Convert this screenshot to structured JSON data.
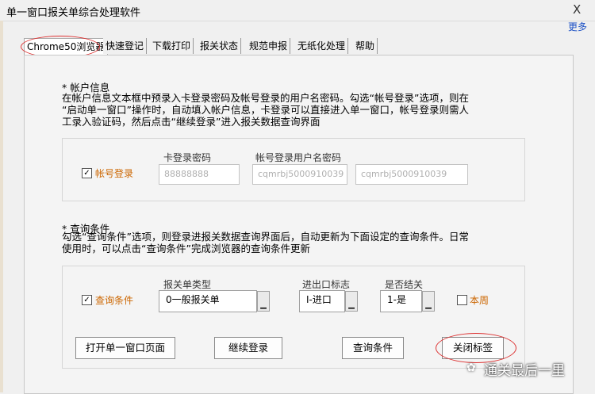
{
  "window": {
    "title": "单一窗口报关单综合处理软件",
    "close": "X",
    "more": "更多"
  },
  "tabs": [
    {
      "label": "Chrome50浏览器"
    },
    {
      "label": "快速登记"
    },
    {
      "label": "下载打印"
    },
    {
      "label": "报关状态"
    },
    {
      "label": "规范申报"
    },
    {
      "label": "无纸化处理"
    },
    {
      "label": "帮助"
    }
  ],
  "account": {
    "heading": "* 帐户信息",
    "desc1": "在帐户信息文本框中预录入卡登录密码及帐号登录的用户名密码。勾选“帐号登录”选项，则在",
    "desc2": "“启动单一窗口”操作时，自动填入帐户信息，卡登录可以直接进入单一窗口，帐号登录则需人",
    "desc3": "工录入验证码，然后点击“继续登录”进入报关数据查询界面",
    "checkbox_label": "帐号登录",
    "card_pwd_label": "卡登录密码",
    "card_pwd_value": "88888888",
    "user_pwd_label": "帐号登录用户名密码",
    "username_value": "cqmrbj5000910039",
    "password_value": "cqmrbj5000910039"
  },
  "query": {
    "heading": "* 查询条件",
    "desc1": "勾选“查询条件”选项，则登录进报关数据查询界面后，自动更新为下面设定的查询条件。日常",
    "desc2": "使用时，可以点击“查询条件”完成浏览器的查询条件更新",
    "checkbox_label": "查询条件",
    "type_label": "报关单类型",
    "type_value": "0一般报关单",
    "io_label": "进出口标志",
    "io_value": "I-进口",
    "closed_label": "是否结关",
    "closed_value": "1-是",
    "week_label": "本周"
  },
  "buttons": {
    "open": "打开单一窗口页面",
    "continue": "继续登录",
    "query": "查询条件",
    "close_tab": "关闭标签"
  },
  "watermark": "通关最后一里"
}
